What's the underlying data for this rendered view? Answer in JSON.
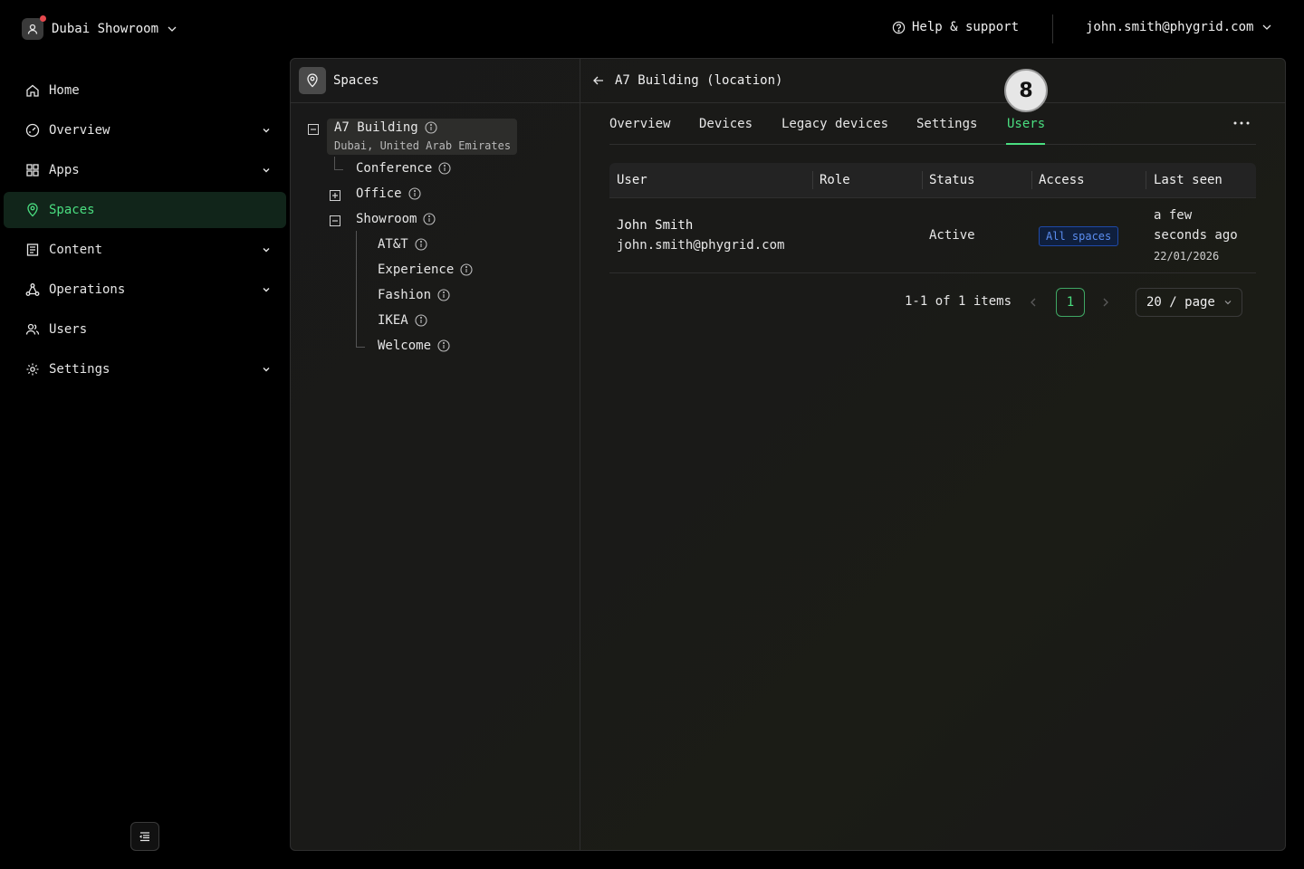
{
  "topbar": {
    "org_name": "Dubai Showroom",
    "help_label": "Help & support",
    "user_email": "john.smith@phygrid.com"
  },
  "sidebar": {
    "items": [
      {
        "label": "Home",
        "icon": "home-icon"
      },
      {
        "label": "Overview",
        "icon": "gauge-icon",
        "expandable": true
      },
      {
        "label": "Apps",
        "icon": "grid-icon",
        "expandable": true
      },
      {
        "label": "Spaces",
        "icon": "location-pin-icon",
        "active": true
      },
      {
        "label": "Content",
        "icon": "document-icon",
        "expandable": true
      },
      {
        "label": "Operations",
        "icon": "network-icon",
        "expandable": true
      },
      {
        "label": "Users",
        "icon": "users-icon"
      },
      {
        "label": "Settings",
        "icon": "gear-icon",
        "expandable": true
      }
    ]
  },
  "spaces": {
    "title": "Spaces",
    "root": {
      "label": "A7 Building",
      "subtitle": "Dubai, United Arab Emirates"
    },
    "children": [
      {
        "label": "Conference"
      },
      {
        "label": "Office",
        "collapsed": true
      },
      {
        "label": "Showroom",
        "expanded": true
      }
    ],
    "showroom_children": [
      {
        "label": "AT&T"
      },
      {
        "label": "Experience"
      },
      {
        "label": "Fashion"
      },
      {
        "label": "IKEA"
      },
      {
        "label": "Welcome"
      }
    ]
  },
  "detail": {
    "title": "A7 Building (location)",
    "tabs": [
      "Overview",
      "Devices",
      "Legacy devices",
      "Settings",
      "Users"
    ],
    "active_tab": "Users",
    "step_badge": "8"
  },
  "table": {
    "columns": [
      "User",
      "Role",
      "Status",
      "Access",
      "Last seen"
    ],
    "rows": [
      {
        "name": "John Smith",
        "email": "john.smith@phygrid.com",
        "role": "",
        "status": "Active",
        "access": "All spaces",
        "last_seen_line1": "a few",
        "last_seen_line2": "seconds ago",
        "last_seen_date": "22/01/2026"
      }
    ]
  },
  "pagination": {
    "total": "1-1 of 1 items",
    "current_page": "1",
    "page_size": "20 / page"
  },
  "colors": {
    "accent": "#4ade80",
    "active_nav_bg": "#11251a",
    "tag_blue": "#5b8def",
    "notification_dot": "#e5484d"
  }
}
